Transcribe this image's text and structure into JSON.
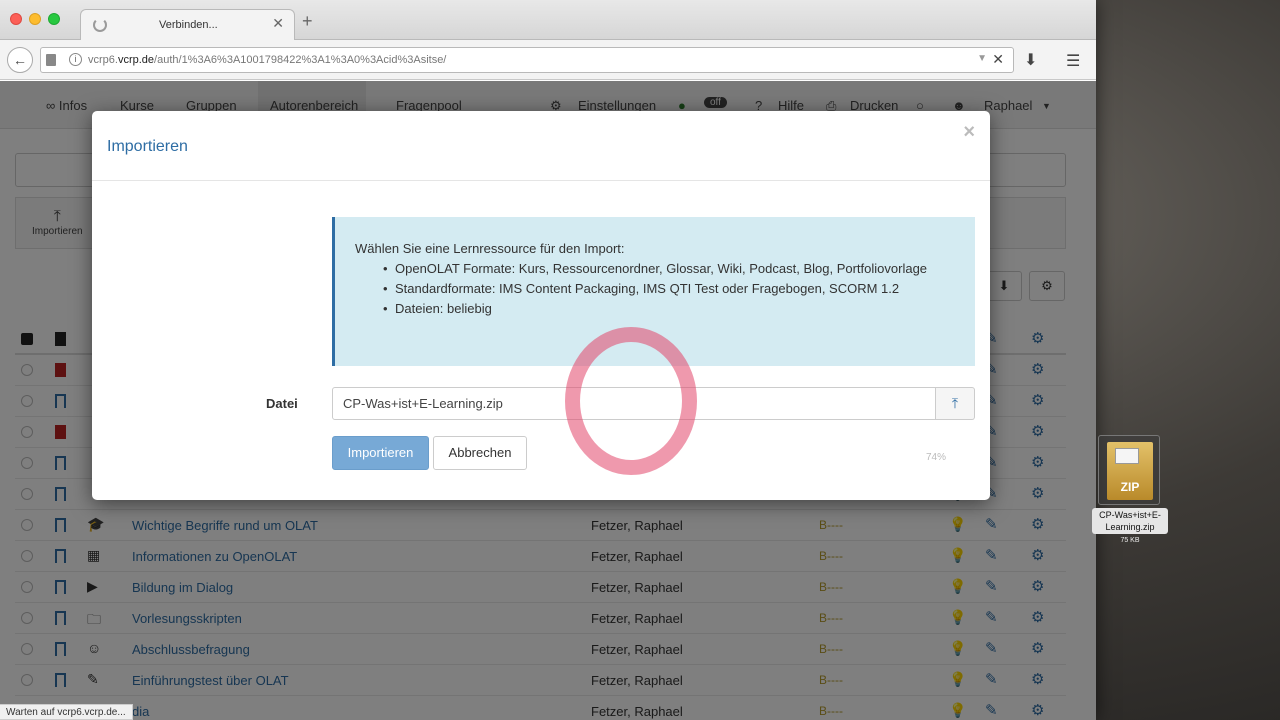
{
  "browser": {
    "tab_title": "Verbinden...",
    "url_prefix": "vcrp6.",
    "url_domain": "vcrp.de",
    "url_path": "/auth/1%3A6%3A1001798422%3A1%3A0%3Acid%3Asitse/",
    "status_text": "Warten auf vcrp6.vcrp.de..."
  },
  "nav": {
    "items": [
      "∞ Infos",
      "Kurse",
      "Gruppen",
      "Autorenbereich",
      "Fragenpool"
    ],
    "right": [
      "Einstellungen",
      "Hilfe",
      "Drucken",
      "Raphael"
    ],
    "toggle": "off"
  },
  "toolbox": {
    "import_label": "Importieren"
  },
  "table": {
    "rows": [
      {
        "name": "",
        "author": "",
        "access": "",
        "bookmark": "filled"
      },
      {
        "name": "",
        "author": "",
        "access": "",
        "bookmark": "outline"
      },
      {
        "name": "",
        "author": "",
        "access": "",
        "bookmark": "filled"
      },
      {
        "name": "",
        "author": "",
        "access": "",
        "bookmark": "outline"
      },
      {
        "name": "",
        "author": "",
        "access": "",
        "bookmark": "outline"
      },
      {
        "name": "Wichtige Begriffe rund um OLAT",
        "author": "Fetzer, Raphael",
        "access": "B----",
        "bookmark": "outline"
      },
      {
        "name": "Informationen zu OpenOLAT",
        "author": "Fetzer, Raphael",
        "access": "B----",
        "bookmark": "outline"
      },
      {
        "name": "Bildung im Dialog",
        "author": "Fetzer, Raphael",
        "access": "B----",
        "bookmark": "outline"
      },
      {
        "name": "Vorlesungsskripten",
        "author": "Fetzer, Raphael",
        "access": "B----",
        "bookmark": "outline"
      },
      {
        "name": "Abschlussbefragung",
        "author": "Fetzer, Raphael",
        "access": "B----",
        "bookmark": "outline"
      },
      {
        "name": "Einführungstest über OLAT",
        "author": "Fetzer, Raphael",
        "access": "B----",
        "bookmark": "outline"
      },
      {
        "name": "dia",
        "author": "Fetzer, Raphael",
        "access": "B----",
        "bookmark": "outline"
      }
    ]
  },
  "modal": {
    "title": "Importieren",
    "close": "×",
    "info_intro": "Wählen Sie eine Lernressource für den Import:",
    "info_items": [
      "OpenOLAT Formate: Kurs, Ressourcenordner, Glossar, Wiki, Podcast, Blog, Portfoliovorlage",
      "Standardformate: IMS Content Packaging, IMS QTI Test oder Fragebogen, SCORM 1.2",
      "Dateien: beliebig"
    ],
    "file_label": "Datei",
    "file_value": "CP-Was+ist+E-Learning.zip",
    "import_button": "Importieren",
    "cancel_button": "Abbrechen",
    "faint_text": "74%"
  },
  "desktop": {
    "file_label": "CP-Was+ist+E-Learning.zip",
    "file_size": "75 KB",
    "icon_text": "ZIP"
  },
  "colors": {
    "accent": "#2e6da4",
    "info_bg": "#d4ebf2",
    "primary_button": "#77a9d6",
    "click_ring": "#e14669"
  }
}
